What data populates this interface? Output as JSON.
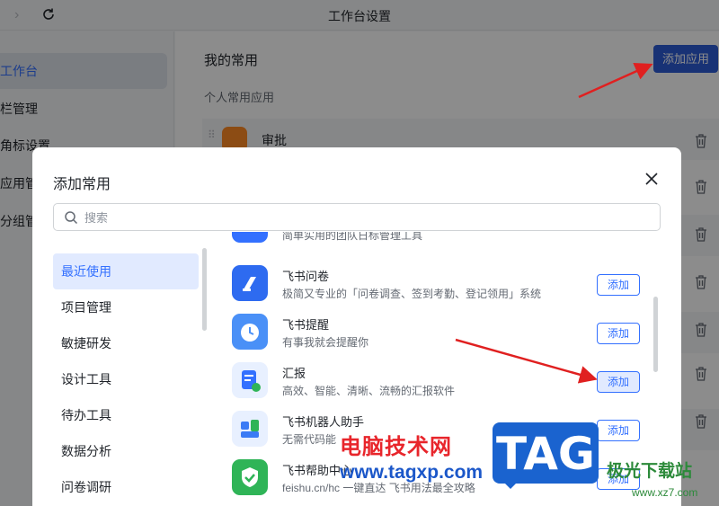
{
  "window": {
    "title": "工作台设置"
  },
  "sidebar": {
    "items": [
      {
        "label": "工作台",
        "active": true
      },
      {
        "label": "栏管理"
      },
      {
        "label": "角标设置"
      },
      {
        "label": "应用管"
      },
      {
        "label": "分组管"
      }
    ]
  },
  "content": {
    "section_title": "我的常用",
    "add_app_label": "添加应用",
    "sub_title": "个人常用应用",
    "rows": [
      {
        "name": "审批"
      }
    ]
  },
  "modal": {
    "title": "添加常用",
    "search_placeholder": "搜索",
    "categories": [
      {
        "label": "最近使用",
        "active": true
      },
      {
        "label": "项目管理"
      },
      {
        "label": "敏捷研发"
      },
      {
        "label": "设计工具"
      },
      {
        "label": "待办工具"
      },
      {
        "label": "数据分析"
      },
      {
        "label": "问卷调研"
      }
    ],
    "apps": [
      {
        "name": "",
        "desc": "简单实用的团队日标管理工具",
        "color": "#3370ff"
      },
      {
        "name": "飞书问卷",
        "desc": "极简又专业的「问卷调查、签到考勤、登记领用」系统",
        "add": "添加",
        "color": "#2e6bf0"
      },
      {
        "name": "飞书提醒",
        "desc": "有事我就会提醒你",
        "add": "添加",
        "color": "#4a90f7"
      },
      {
        "name": "汇报",
        "desc": "高效、智能、清晰、流畅的汇报软件",
        "add": "添加",
        "color": "#3370ff"
      },
      {
        "name": "飞书机器人助手",
        "desc": "无需代码能",
        "add": "添加",
        "color": "#3b7bf5"
      },
      {
        "name": "飞书帮助中心",
        "desc": "feishu.cn/hc 一键直达 飞书用法最全攻略",
        "add": "添加",
        "color": "#2fb457"
      }
    ]
  },
  "watermark": {
    "cn": "电脑技术网",
    "url": "www.tagxp.com",
    "tag": "TAG",
    "logo": "极光下载站",
    "site": "www.xz7.com"
  },
  "colors": {
    "accent": "#3370ff",
    "primary_button": "#2c5bd6",
    "arrow": "#e02020"
  }
}
